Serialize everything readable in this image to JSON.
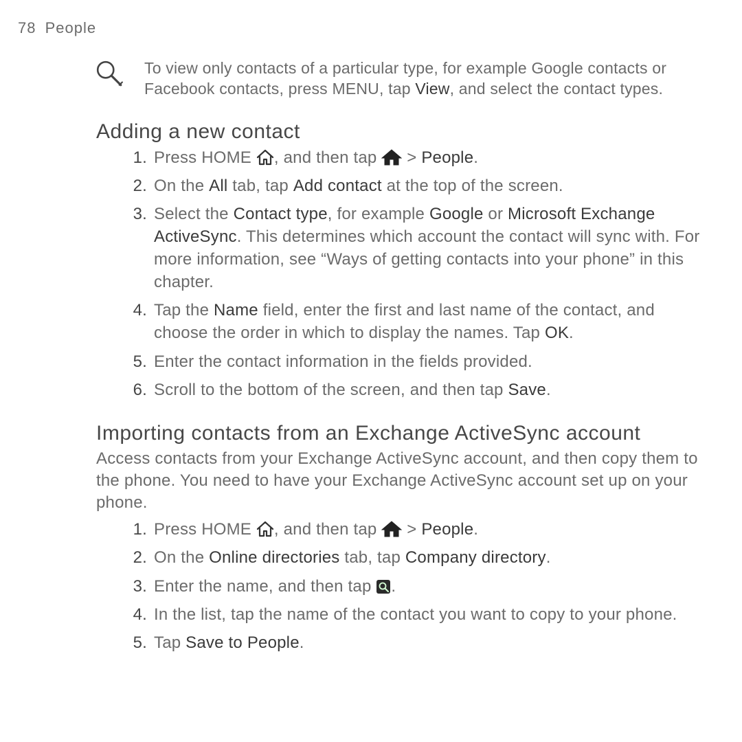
{
  "header": {
    "page_number": "78",
    "section": "People"
  },
  "tip": {
    "text_pre": "To view only contacts of a particular type, for example Google contacts or Facebook contacts, press MENU, tap ",
    "view_word": "View",
    "text_post": ", and select the contact types."
  },
  "sec1": {
    "title": "Adding a new contact",
    "s1": {
      "a": "Press HOME ",
      "b": ", and then tap ",
      "c": " > ",
      "people": "People",
      "d": "."
    },
    "s2": {
      "a": "On the ",
      "all": "All",
      "b": " tab, tap ",
      "add": "Add contact",
      "c": " at the top of the screen."
    },
    "s3": {
      "a": "Select the ",
      "ct": "Contact type",
      "b": ", for example ",
      "g": "Google",
      "c": " or ",
      "mx": "Microsoft Exchange ActiveSync",
      "d": ". This determines which account the contact will sync with. For more information, see “Ways of getting contacts into your phone” in this chapter."
    },
    "s4": {
      "a": "Tap the ",
      "name": "Name",
      "b": " field, enter the first and last name of the contact, and choose the order in which to display the names. Tap ",
      "ok": "OK",
      "c": "."
    },
    "s5": {
      "a": "Enter the contact information in the fields provided."
    },
    "s6": {
      "a": "Scroll to the bottom of the screen, and then tap ",
      "save": "Save",
      "b": "."
    }
  },
  "sec2": {
    "title": "Importing contacts from an Exchange ActiveSync account",
    "intro": "Access contacts from your Exchange ActiveSync account, and then copy them to the phone. You need to have your Exchange ActiveSync account set up on your phone.",
    "s1": {
      "a": "Press HOME ",
      "b": ", and then tap ",
      "c": " > ",
      "people": "People",
      "d": "."
    },
    "s2": {
      "a": "On the ",
      "od": "Online directories",
      "b": " tab, tap ",
      "cd": "Company directory",
      "c": "."
    },
    "s3": {
      "a": "Enter the name, and then tap ",
      "b": "."
    },
    "s4": {
      "a": "In the list, tap the name of the contact you want to copy to your phone."
    },
    "s5": {
      "a": "Tap ",
      "stp": "Save to People",
      "b": "."
    }
  }
}
